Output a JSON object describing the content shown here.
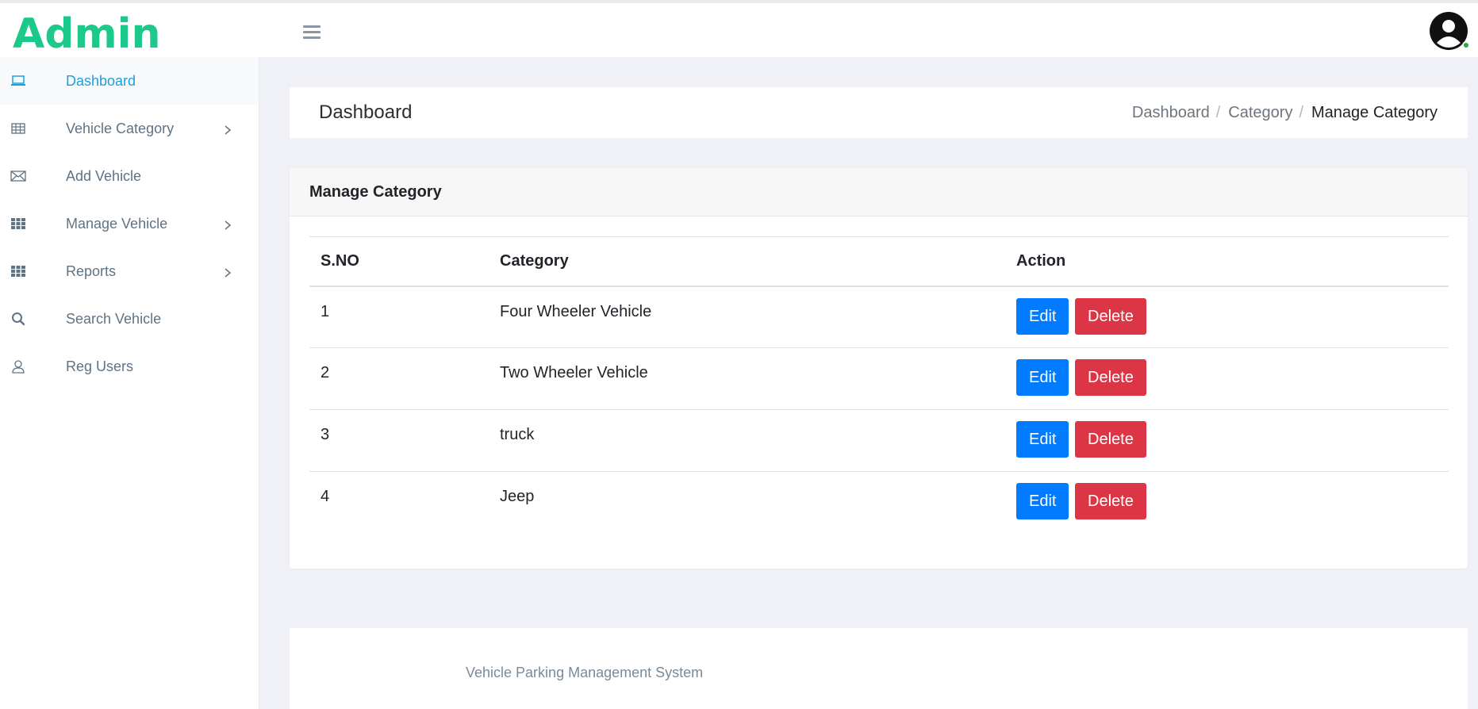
{
  "brand": {
    "title": "Admin",
    "color": "#1cc88a"
  },
  "header": {
    "menu_icon": "hamburger-icon",
    "avatar_icon": "user-avatar-icon",
    "status": "online"
  },
  "sidebar": {
    "items": [
      {
        "label": "Dashboard",
        "icon": "laptop-icon",
        "active": true,
        "has_submenu": false
      },
      {
        "label": "Vehicle Category",
        "icon": "table-icon",
        "active": false,
        "has_submenu": true
      },
      {
        "label": "Add Vehicle",
        "icon": "envelope-icon",
        "active": false,
        "has_submenu": false
      },
      {
        "label": "Manage Vehicle",
        "icon": "grid-icon",
        "active": false,
        "has_submenu": true
      },
      {
        "label": "Reports",
        "icon": "grid-icon",
        "active": false,
        "has_submenu": true
      },
      {
        "label": "Search Vehicle",
        "icon": "search-icon",
        "active": false,
        "has_submenu": false
      },
      {
        "label": "Reg Users",
        "icon": "user-icon",
        "active": false,
        "has_submenu": false
      }
    ]
  },
  "page_header": {
    "title": "Dashboard",
    "breadcrumb": [
      "Dashboard",
      "Category",
      "Manage Category"
    ]
  },
  "card": {
    "title": "Manage Category",
    "columns": [
      "S.NO",
      "Category",
      "Action"
    ],
    "rows": [
      {
        "sno": "1",
        "category": "Four Wheeler Vehicle"
      },
      {
        "sno": "2",
        "category": "Two Wheeler Vehicle"
      },
      {
        "sno": "3",
        "category": "truck"
      },
      {
        "sno": "4",
        "category": "Jeep"
      }
    ],
    "edit_label": "Edit",
    "delete_label": "Delete",
    "edit_color": "#007bff",
    "delete_color": "#dc3545"
  },
  "footer": {
    "text": "Vehicle Parking Management System"
  }
}
